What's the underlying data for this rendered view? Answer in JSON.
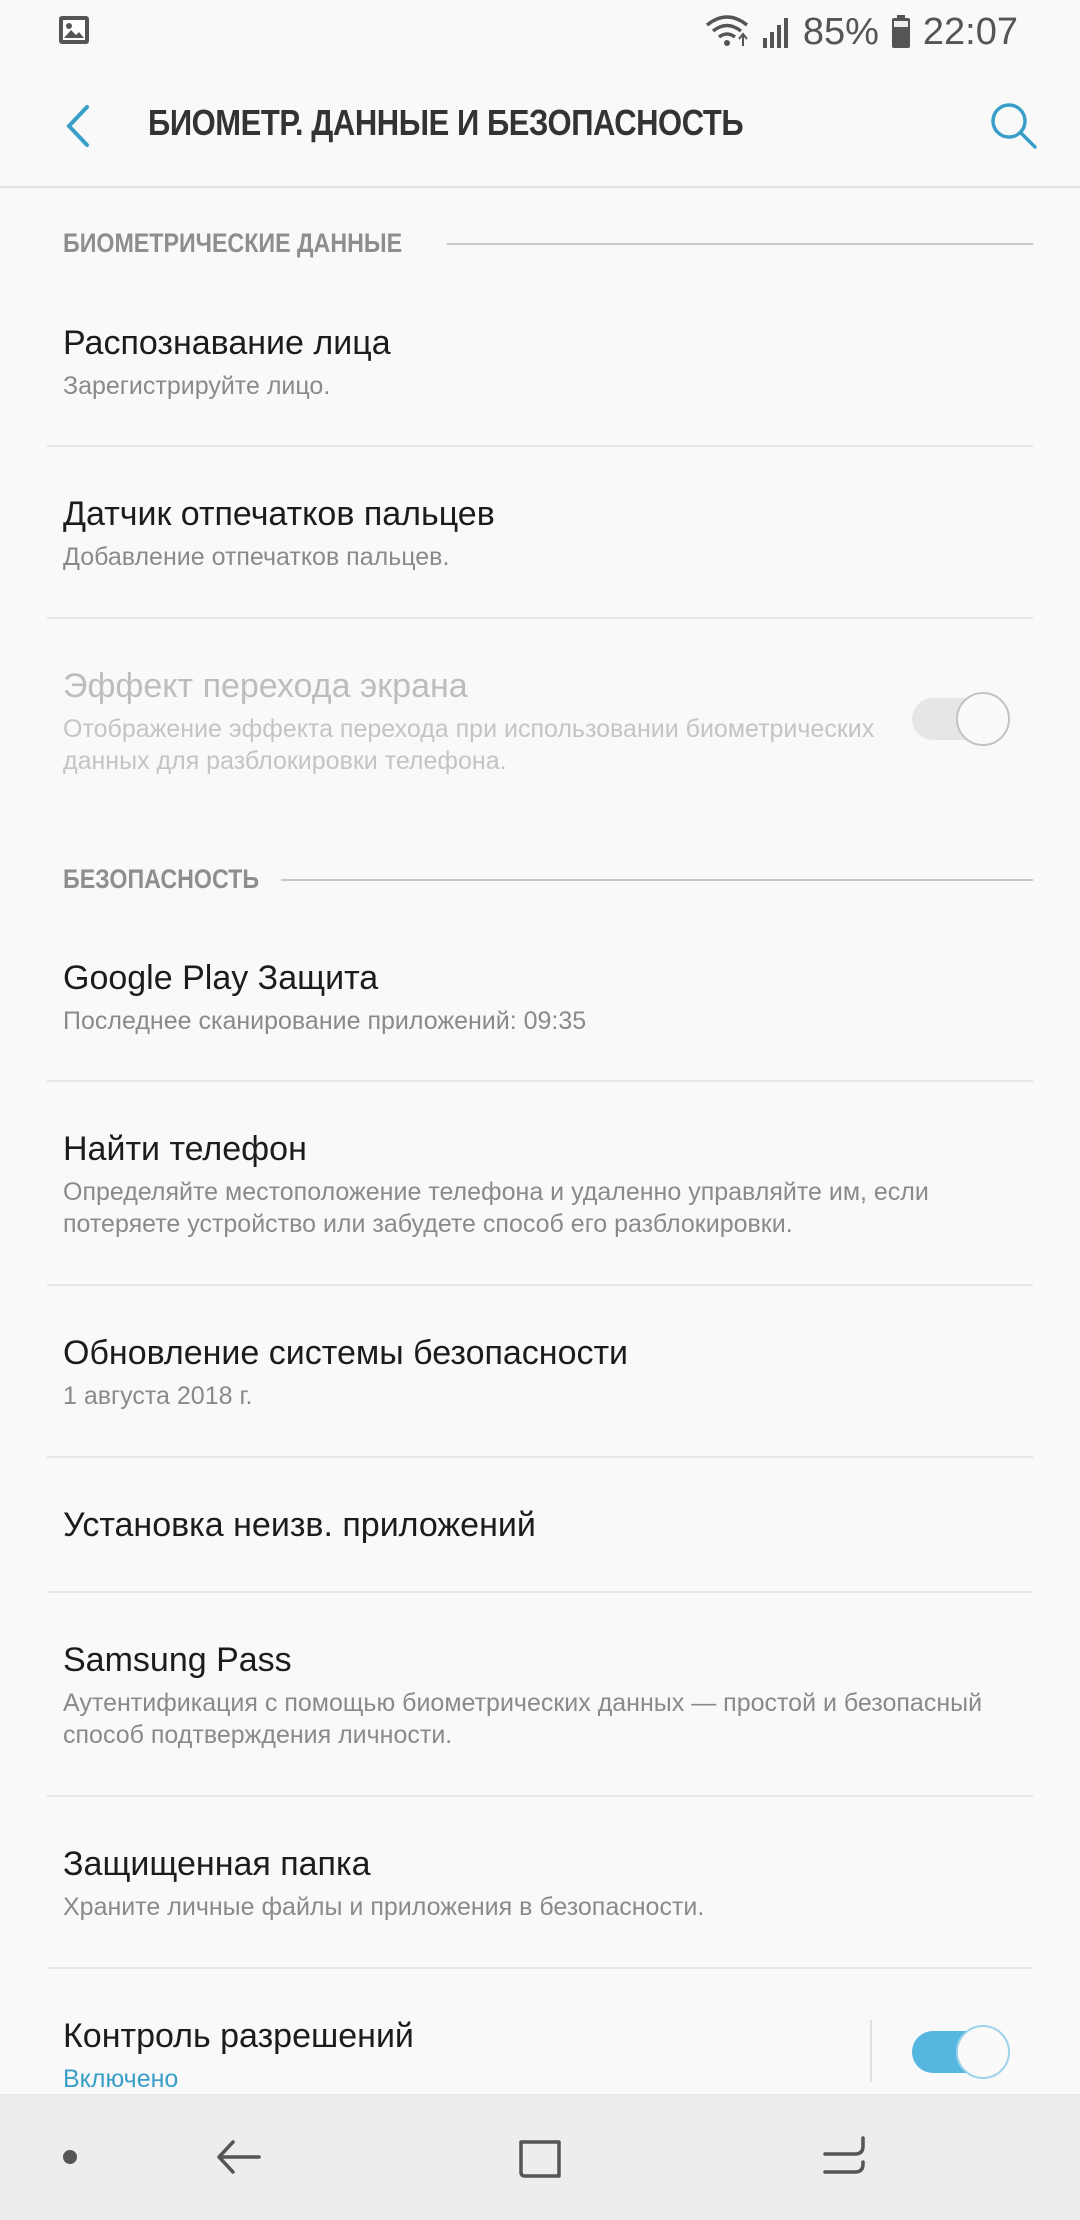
{
  "status_bar": {
    "battery": "85%",
    "time": "22:07",
    "icons": [
      "gallery-notification-icon",
      "wifi-icon",
      "signal-icon",
      "battery-icon"
    ]
  },
  "header": {
    "title": "БИОМЕТР. ДАННЫЕ И БЕЗОПАСНОСТЬ",
    "back_icon": "chevron-left-icon",
    "search_icon": "search-icon"
  },
  "sections": {
    "biometrics": {
      "title": "БИОМЕТРИЧЕСКИЕ ДАННЫЕ",
      "items": [
        {
          "title": "Распознавание лица",
          "subtitle": "Зарегистрируйте лицо."
        },
        {
          "title": "Датчик отпечатков пальцев",
          "subtitle": "Добавление отпечатков пальцев."
        },
        {
          "title": "Эффект перехода экрана",
          "subtitle": "Отображение эффекта перехода при использовании биометрических данных для разблокировки телефона.",
          "toggle": "off",
          "disabled": true
        }
      ]
    },
    "security": {
      "title": "БЕЗОПАСНОСТЬ",
      "items": [
        {
          "title": "Google Play Защита",
          "subtitle": "Последнее сканирование приложений: 09:35"
        },
        {
          "title": "Найти телефон",
          "subtitle": "Определяйте местоположение телефона и удаленно управляйте им, если потеряете устройство или забудете способ его разблокировки."
        },
        {
          "title": "Обновление системы безопасности",
          "subtitle": "1 августа 2018 г."
        },
        {
          "title": "Установка неизв. приложений"
        },
        {
          "title": "Samsung Pass",
          "subtitle": "Аутентификация с помощью биометрических данных — простой и безопасный способ подтверждения личности."
        },
        {
          "title": "Защищенная папка",
          "subtitle": "Храните личные файлы и приложения в безопасности."
        },
        {
          "title": "Контроль разрешений",
          "subtitle": "Включено",
          "toggle": "on"
        }
      ]
    }
  },
  "nav_bar": {
    "icons": [
      "dot-icon",
      "back-arrow-icon",
      "home-square-icon",
      "recents-icon"
    ]
  },
  "colors": {
    "accent": "#3a9fc8",
    "toggle_on": "#55b7df",
    "background": "#f9f9f9"
  }
}
